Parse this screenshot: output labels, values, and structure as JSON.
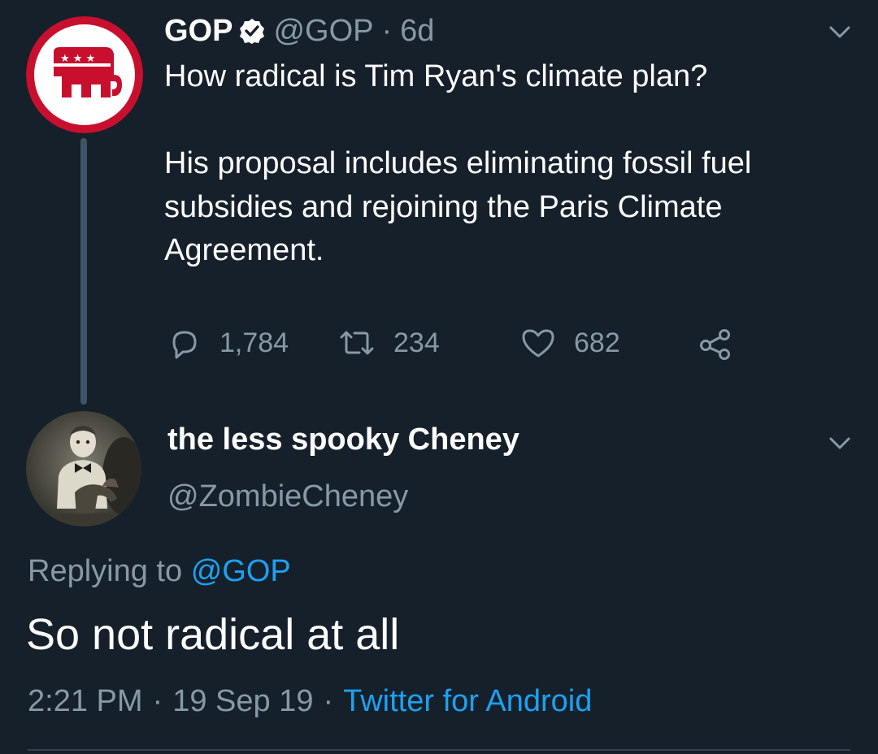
{
  "parent_tweet": {
    "author_name": "GOP",
    "handle": "@GOP",
    "separator": "·",
    "time_ago": "6d",
    "text_paragraphs": [
      "How radical is Tim Ryan's climate plan?",
      "His proposal includes eliminating fossil fuel subsidies and rejoining the Paris Climate Agreement."
    ],
    "avatar": {
      "icon": "gop-elephant-logo",
      "ring_color": "#c8102e",
      "stars": "★★★"
    },
    "verified_icon": "verified-badge-icon",
    "menu_icon": "chevron-down-icon",
    "stats": {
      "replies": "1,784",
      "retweets": "234",
      "likes": "682"
    }
  },
  "reply_tweet": {
    "author_name": "the less spooky Cheney",
    "handle": "@ZombieCheney",
    "replying_to_label": "Replying to",
    "replying_to_handle": "@GOP",
    "text": "So not radical at all",
    "time": "2:21 PM",
    "date": "19 Sep 19",
    "separator": "·",
    "source": "Twitter for Android",
    "avatar": {
      "icon": "vintage-photo-avatar"
    },
    "menu_icon": "chevron-down-icon"
  },
  "colors": {
    "background": "#15202b",
    "text": "#ffffff",
    "secondary_text": "#8899a6",
    "link": "#1da1f2",
    "thread_line": "#3d5466",
    "brand_red": "#c8102e"
  }
}
